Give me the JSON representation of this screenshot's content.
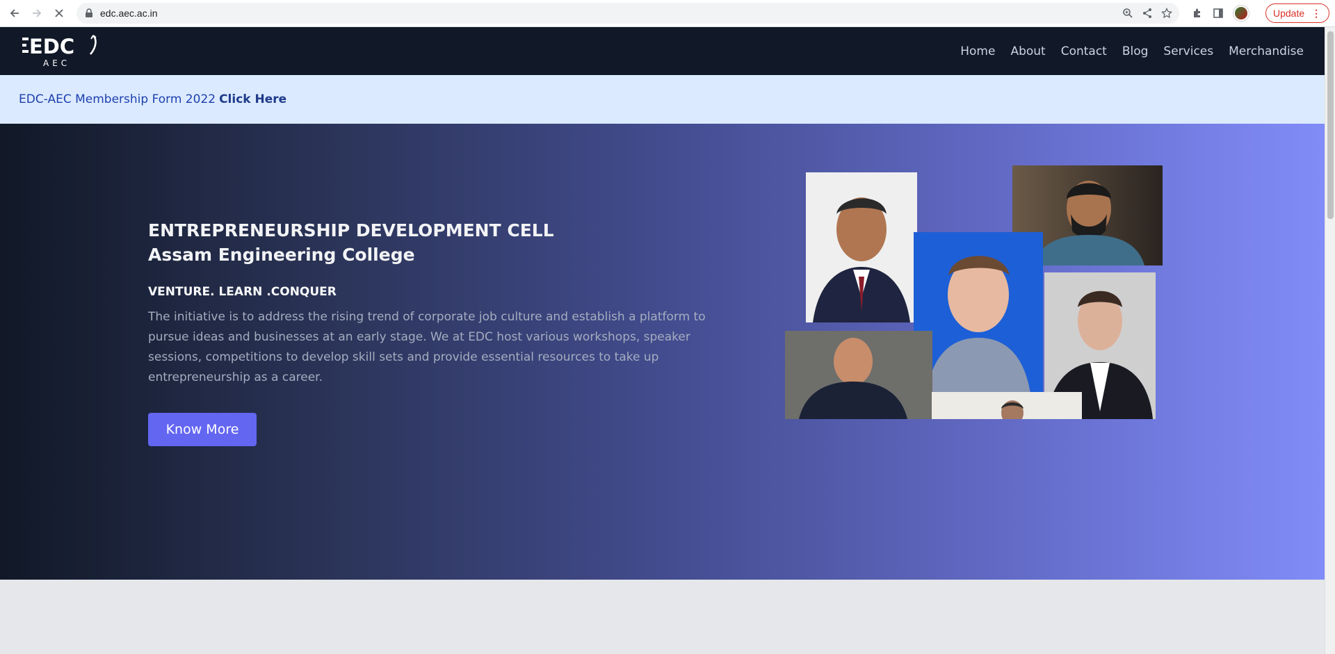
{
  "browser": {
    "url": "edc.aec.ac.in",
    "update_label": "Update"
  },
  "header": {
    "logo_text": "EDC",
    "logo_subtext": "AEC",
    "nav": [
      "Home",
      "About",
      "Contact",
      "Blog",
      "Services",
      "Merchandise"
    ]
  },
  "banner": {
    "text": "EDC-AEC Membership Form 2022",
    "link": "Click Here"
  },
  "hero": {
    "title_line1": "ENTREPRENEURSHIP DEVELOPMENT CELL",
    "title_line2": "Assam Engineering College",
    "tagline": "VENTURE. LEARN .CONQUER",
    "description": "The initiative is to address the rising trend of corporate job culture and establish a platform to pursue ideas and businesses at an early stage. We at EDC host various workshops, speaker sessions, competitions to develop skill sets and provide essential resources to take up entrepreneurship as a career.",
    "button_label": "Know More"
  },
  "colors": {
    "header_bg": "#111827",
    "banner_bg": "#dbeafe",
    "accent": "#6366f1",
    "hero_gradient_end": "#818cf8"
  }
}
